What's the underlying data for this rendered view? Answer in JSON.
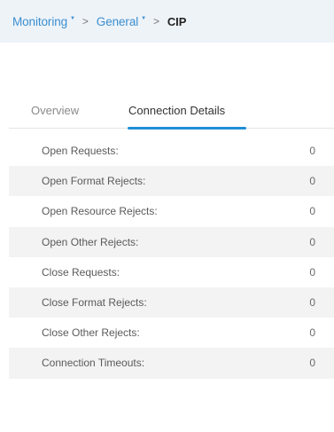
{
  "breadcrumb": {
    "items": [
      {
        "label": "Monitoring"
      },
      {
        "label": "General"
      }
    ],
    "separator": ">",
    "current": "CIP"
  },
  "tabs": [
    {
      "label": "Overview",
      "active": false
    },
    {
      "label": "Connection Details",
      "active": true
    }
  ],
  "rows": [
    {
      "label": "Open Requests:",
      "value": "0"
    },
    {
      "label": "Open Format Rejects:",
      "value": "0"
    },
    {
      "label": "Open Resource Rejects:",
      "value": "0"
    },
    {
      "label": "Open Other Rejects:",
      "value": "0"
    },
    {
      "label": "Close Requests:",
      "value": "0"
    },
    {
      "label": "Close Format Rejects:",
      "value": "0"
    },
    {
      "label": "Close Other Rejects:",
      "value": "0"
    },
    {
      "label": "Connection Timeouts:",
      "value": "0"
    }
  ],
  "colors": {
    "link": "#3b8ed0",
    "active_tab_indicator": "#1f8fd6",
    "breadcrumb_bg": "#eef3f8",
    "row_alt_bg": "#f3f3f3"
  },
  "icons": {
    "caret": "caret-down-icon"
  }
}
